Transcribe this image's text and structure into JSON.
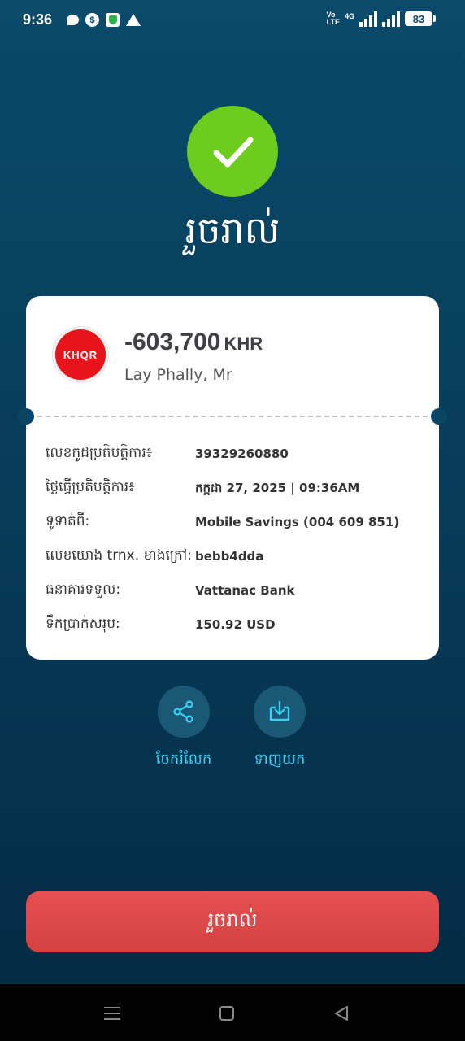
{
  "status_bar": {
    "time": "9:36",
    "volte_top": "Vo",
    "volte_bottom": "LTE",
    "network": "4G",
    "battery": "83"
  },
  "success": {
    "title": "រួចរាល់"
  },
  "card": {
    "bank_logo_text": "KHQR",
    "amount": "-603,700",
    "currency": "KHR",
    "payee": "Lay Phally, Mr",
    "details": [
      {
        "label": "លេខកូដប្រតិបត្តិការ៖",
        "value": "39329260880"
      },
      {
        "label": "ថ្ងៃធ្វើប្រតិបត្តិការ៖",
        "value": "កក្កដា 27, 2025 | 09:36AM"
      },
      {
        "label": "ទូទាត់ពី:",
        "value": "Mobile Savings (004 609 851)"
      },
      {
        "label": "លេខយោង trnx. ខាងក្រៅ:",
        "value": "bebb4dda"
      },
      {
        "label": "ធនាគារទទួល:",
        "value": "Vattanac Bank"
      },
      {
        "label": "ទឹកប្រាក់សរុប:",
        "value": "150.92 USD"
      }
    ]
  },
  "actions": {
    "share_label": "ចែករំលែក",
    "download_label": "ទាញយក"
  },
  "done_button": "រួចរាល់",
  "colors": {
    "success_green": "#6dcc1e",
    "accent_cyan": "#3ad0f2",
    "button_red": "#e04848",
    "background": "#0a4566"
  }
}
